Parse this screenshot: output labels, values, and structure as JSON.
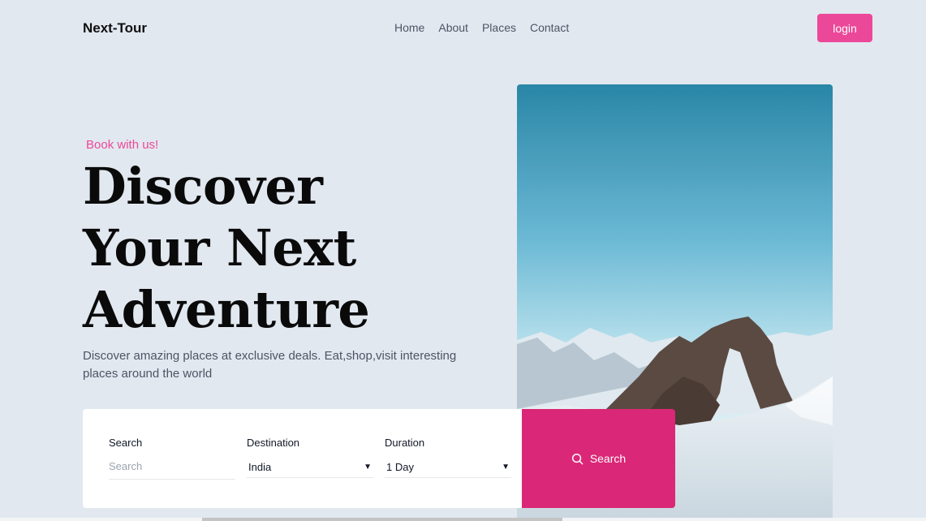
{
  "nav": {
    "brand": "Next-Tour",
    "links": [
      "Home",
      "About",
      "Places",
      "Contact"
    ],
    "login_label": "login"
  },
  "hero": {
    "tagline": "Book with us!",
    "headline": [
      "Discover",
      "Your Next",
      "Adventure"
    ],
    "description": "Discover amazing places at exclusive deals. Eat,shop,visit interesting places around the world"
  },
  "search": {
    "search_label": "Search",
    "search_placeholder": "Search",
    "destination_label": "Destination",
    "destination_value": "India",
    "duration_label": "Duration",
    "duration_value": "1 Day",
    "button_label": "Search"
  },
  "colors": {
    "accent": "#ec4899",
    "search_button": "#db2777",
    "background": "#e2e8f0"
  }
}
